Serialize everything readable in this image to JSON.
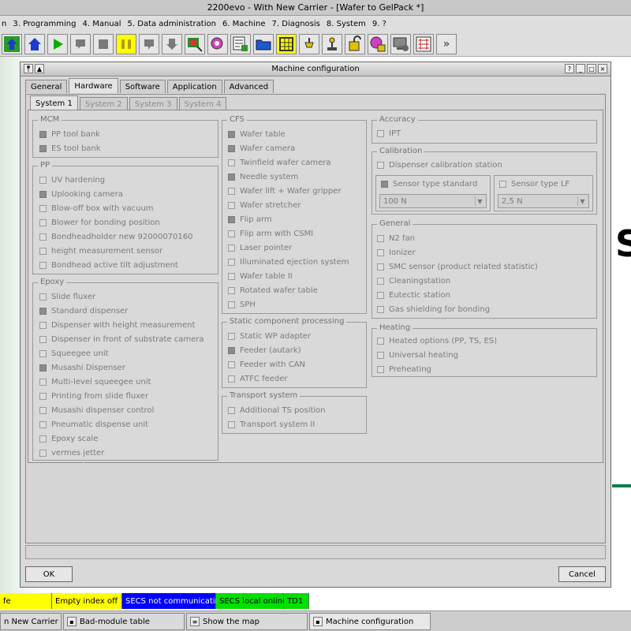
{
  "window": {
    "title": "2200evo - With New Carrier - [Wafer to GelPack *]"
  },
  "menu": {
    "items": [
      {
        "label": "n"
      },
      {
        "label": "3. Programming"
      },
      {
        "label": "4. Manual"
      },
      {
        "label": "5. Data administration"
      },
      {
        "label": "6. Machine"
      },
      {
        "label": "7. Diagnosis"
      },
      {
        "label": "8. System"
      },
      {
        "label": "9. ?"
      }
    ]
  },
  "toolbar": {
    "overflow_label": "»"
  },
  "background": {
    "partial_text": "S"
  },
  "dialog": {
    "title": "Machine configuration",
    "help_label": "?",
    "minimize_label": "_",
    "maximize_label": "□",
    "close_label": "×",
    "ok_label": "OK",
    "cancel_label": "Cancel"
  },
  "tabs": [
    {
      "label": "General"
    },
    {
      "label": "Hardware"
    },
    {
      "label": "Software"
    },
    {
      "label": "Application"
    },
    {
      "label": "Advanced"
    }
  ],
  "subtabs": [
    {
      "label": "System 1"
    },
    {
      "label": "System 2"
    },
    {
      "label": "System 3"
    },
    {
      "label": "System 4"
    }
  ],
  "groups": {
    "mcm": {
      "title": "MCM",
      "items": [
        {
          "label": "PP tool bank",
          "checked": true
        },
        {
          "label": "ES tool bank",
          "checked": true
        }
      ]
    },
    "pp": {
      "title": "PP",
      "items": [
        {
          "label": "UV hardening",
          "checked": false
        },
        {
          "label": "Uplooking camera",
          "checked": true
        },
        {
          "label": "Blow-off box with vacuum",
          "checked": false
        },
        {
          "label": "Blower for bonding position",
          "checked": false
        },
        {
          "label": "Bondheadholder new 92000070160",
          "checked": false
        },
        {
          "label": "height measurement sensor",
          "checked": false
        },
        {
          "label": "Bondhead active tilt adjustment",
          "checked": false
        }
      ]
    },
    "epoxy": {
      "title": "Epoxy",
      "items": [
        {
          "label": "Slide fluxer",
          "checked": false
        },
        {
          "label": "Standard dispenser",
          "checked": true
        },
        {
          "label": "Dispenser with height measurement",
          "checked": false
        },
        {
          "label": "Dispenser in front of substrate camera",
          "checked": false
        },
        {
          "label": "Squeegee unit",
          "checked": false
        },
        {
          "label": "Musashi Dispenser",
          "checked": true
        },
        {
          "label": "Multi-level squeegee unit",
          "checked": false
        },
        {
          "label": "Printing from slide fluxer",
          "checked": false
        },
        {
          "label": "Musashi dispenser control",
          "checked": false
        },
        {
          "label": "Pneumatic dispense unit",
          "checked": false
        },
        {
          "label": "Epoxy scale",
          "checked": false
        },
        {
          "label": "vermes jetter",
          "checked": false
        }
      ]
    },
    "cfs": {
      "title": "CFS",
      "items": [
        {
          "label": "Wafer table",
          "checked": true
        },
        {
          "label": "Wafer camera",
          "checked": true
        },
        {
          "label": "Twinfield wafer camera",
          "checked": false
        },
        {
          "label": "Needle system",
          "checked": true
        },
        {
          "label": "Wafer lift + Wafer gripper",
          "checked": false
        },
        {
          "label": "Wafer stretcher",
          "checked": false
        },
        {
          "label": "Flip arm",
          "checked": true
        },
        {
          "label": "Flip arm with CSMI",
          "checked": false
        },
        {
          "label": "Laser pointer",
          "checked": false
        },
        {
          "label": "Illuminated ejection system",
          "checked": false
        },
        {
          "label": "Wafer table II",
          "checked": false
        },
        {
          "label": "Rotated wafer table",
          "checked": false
        },
        {
          "label": "SPH",
          "checked": false
        }
      ]
    },
    "static": {
      "title": "Static component processing",
      "items": [
        {
          "label": "Static WP adapter",
          "checked": false
        },
        {
          "label": "Feeder (autark)",
          "checked": true
        },
        {
          "label": "Feeder with CAN",
          "checked": false
        },
        {
          "label": "ATFC feeder",
          "checked": false
        }
      ]
    },
    "transport": {
      "title": "Transport system",
      "items": [
        {
          "label": "Additional TS position",
          "checked": false
        },
        {
          "label": "Transport system II",
          "checked": false
        }
      ]
    },
    "accuracy": {
      "title": "Accuracy",
      "items": [
        {
          "label": "IPT",
          "checked": false
        }
      ]
    },
    "calibration": {
      "title": "Calibration",
      "station": {
        "label": "Dispenser calibration station",
        "checked": false
      },
      "standard": {
        "label": "Sensor type standard",
        "checked": true,
        "value": "100 N"
      },
      "lf": {
        "label": "Sensor type LF",
        "checked": false,
        "value": "2,5 N"
      }
    },
    "general": {
      "title": "General",
      "items": [
        {
          "label": "N2 fan",
          "checked": false
        },
        {
          "label": "Ionizer",
          "checked": false
        },
        {
          "label": "SMC sensor (product related statistic)",
          "checked": false
        },
        {
          "label": "Cleaningstation",
          "checked": false
        },
        {
          "label": "Eutectic station",
          "checked": false
        },
        {
          "label": "Gas shielding for bonding",
          "checked": false
        }
      ]
    },
    "heating": {
      "title": "Heating",
      "items": [
        {
          "label": "Heated options (PP, TS, ES)",
          "checked": false
        },
        {
          "label": "Universal heating",
          "checked": false
        },
        {
          "label": "Preheating",
          "checked": false
        }
      ]
    }
  },
  "statusbar": [
    {
      "label": "fe",
      "color": "#ffff00",
      "text_color": "#000000"
    },
    {
      "label": "Empty index off",
      "color": "#ffff00",
      "text_color": "#000000"
    },
    {
      "label": "SECS not communicating",
      "color": "#0000ff",
      "text_color": "#ffffff"
    },
    {
      "label": "SECS local online",
      "color": "#00e000",
      "text_color": "#000000"
    },
    {
      "label": "TD1",
      "color": "#00e000",
      "text_color": "#000000"
    }
  ],
  "taskbar": [
    {
      "label": "n New Carrier - [Wa"
    },
    {
      "label": "Bad-module table"
    },
    {
      "label": "Show the map"
    },
    {
      "label": "Machine configuration"
    }
  ]
}
